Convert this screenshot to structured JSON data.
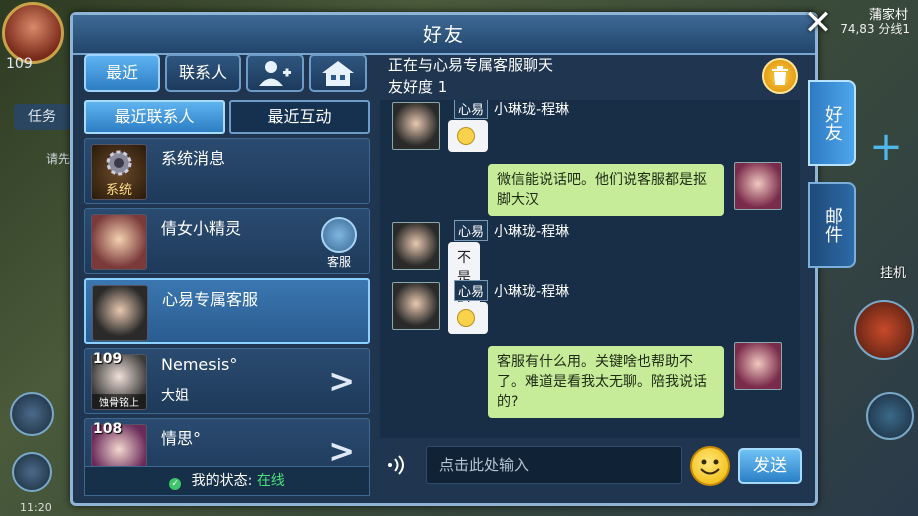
{
  "background": {
    "level": "109",
    "task_label": "任务",
    "hint": "请先",
    "location": "蒲家村",
    "coords": "74,83 分线1",
    "time": "11:20",
    "hang_label": "挂机"
  },
  "panel": {
    "title": "好友"
  },
  "tabs": {
    "recent": "最近",
    "contacts": "联系人",
    "add_friend_icon": "add-friend-icon",
    "home_icon": "home-icon"
  },
  "sub_tabs": {
    "recent_contacts": "最近联系人",
    "recent_interactions": "最近互动"
  },
  "contacts": [
    {
      "name": "系统消息",
      "avatar_label": "系统"
    },
    {
      "name": "倩女小精灵",
      "badge": "客服"
    },
    {
      "name": "心易专属客服"
    },
    {
      "name": "Nemesis°",
      "level": "109",
      "subtitle": "大姐",
      "avatar_label": "蚀骨铭上"
    },
    {
      "name": "情思°",
      "level": "108"
    }
  ],
  "status": {
    "label": "我的状态:",
    "value": "在线"
  },
  "chat": {
    "title": "正在与心易专属客服聊天",
    "friendship": "友好度 1",
    "messages": [
      {
        "side": "left",
        "sender_tag": "心易",
        "sender_name": "小琳珑-程琳",
        "text": "",
        "emoji": true
      },
      {
        "side": "right",
        "text": "微信能说话吧。他们说客服都是抠脚大汉"
      },
      {
        "side": "left",
        "sender_tag": "心易",
        "sender_name": "小琳珑-程琳",
        "text": "不是的~"
      },
      {
        "side": "left",
        "sender_tag": "心易",
        "sender_name": "小琳珑-程琳",
        "text": "",
        "emoji": true
      },
      {
        "side": "right",
        "text": "客服有什么用。关键啥也帮助不了。难道是看我太无聊。陪我说话的?"
      }
    ],
    "input_placeholder": "点击此处输入",
    "send_label": "发送"
  },
  "side_tabs": {
    "friends": "好友",
    "mail": "邮件"
  },
  "colors": {
    "accent": "#2d7ec4",
    "online": "#4be07a",
    "bubble_self": "#c6ec9a",
    "bubble_other": "#f2f4f7"
  }
}
